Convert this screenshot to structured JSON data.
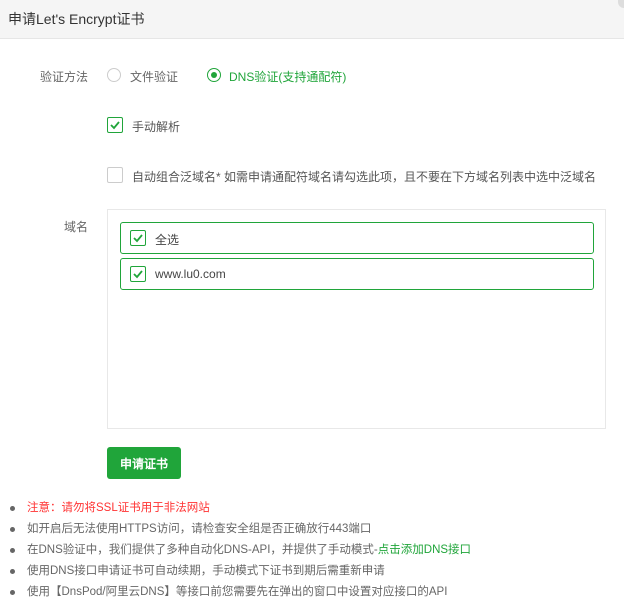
{
  "dialog": {
    "title": "申请Let's Encrypt证书"
  },
  "verify": {
    "label": "验证方法",
    "options": [
      {
        "label": "文件验证",
        "selected": false
      },
      {
        "label": "DNS验证(支持通配符)",
        "selected": true
      }
    ]
  },
  "manual_resolve": {
    "label": "手动解析",
    "checked": true
  },
  "auto_wildcard": {
    "label": "自动组合泛域名* 如需申请通配符域名请勾选此项，且不要在下方域名列表中选中泛域名",
    "checked": false
  },
  "domains": {
    "label": "域名",
    "items": [
      {
        "label": "全选",
        "checked": true
      },
      {
        "label": "www.lu0.com",
        "checked": true
      }
    ]
  },
  "submit_label": "申请证书",
  "notes": [
    {
      "text": "注意：请勿将SSL证书用于非法网站"
    },
    {
      "text": "如开启后无法使用HTTPS访问，请检查安全组是否正确放行443端口"
    },
    {
      "text": "在DNS验证中，我们提供了多种自动化DNS-API，并提供了手动模式-",
      "link": "点击添加DNS接口"
    },
    {
      "text": "使用DNS接口申请证书可自动续期，手动模式下证书到期后需重新申请"
    },
    {
      "text": "使用【DnsPod/阿里云DNS】等接口前您需要先在弹出的窗口中设置对应接口的API"
    }
  ],
  "colors": {
    "accent": "#20a53a",
    "warning": "#ff3333"
  }
}
